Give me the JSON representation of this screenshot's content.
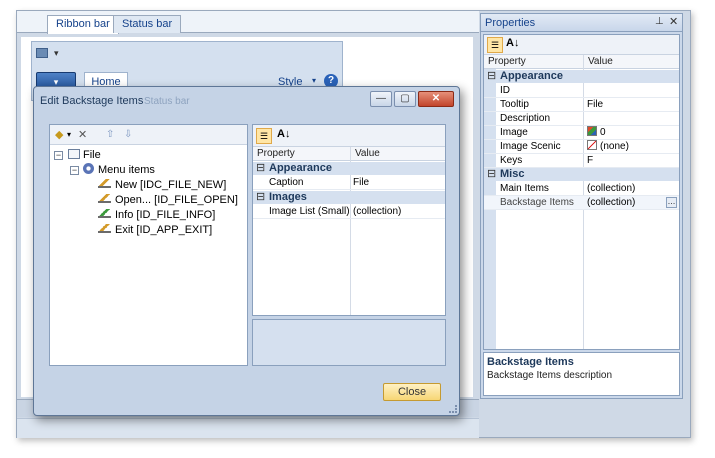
{
  "editor": {
    "tabs": [
      {
        "label": "Ribbon bar",
        "active": true
      },
      {
        "label": "Status bar",
        "active": false
      }
    ]
  },
  "ribbon": {
    "home_tab": "Home",
    "style_label": "Style",
    "help_glyph": "?",
    "app_button_glyph": "▾"
  },
  "dialog": {
    "title": "Edit Backstage Items",
    "ghost_text": "Status bar",
    "min_glyph": "—",
    "max_glyph": "▢",
    "close_glyph": "✕",
    "close_button": "Close",
    "tree": {
      "root": "File",
      "group": "Menu items",
      "items": [
        {
          "label": "New [IDC_FILE_NEW]",
          "icon": "command-icon"
        },
        {
          "label": "Open... [ID_FILE_OPEN]",
          "icon": "command-icon"
        },
        {
          "label": "Info [ID_FILE_INFO]",
          "icon": "command-icon-green"
        },
        {
          "label": "Exit [ID_APP_EXIT]",
          "icon": "command-icon"
        }
      ]
    },
    "grid": {
      "col_property": "Property",
      "col_value": "Value",
      "categories": [
        {
          "name": "Appearance",
          "rows": [
            {
              "name": "Caption",
              "value": "File"
            }
          ]
        },
        {
          "name": "Images",
          "rows": [
            {
              "name": "Image List (Small)",
              "value": "(collection)"
            }
          ]
        }
      ]
    }
  },
  "properties": {
    "title": "Properties",
    "pin_glyph": "⊥",
    "close_glyph": "✕",
    "col_property": "Property",
    "col_value": "Value",
    "appearance": {
      "name": "Appearance",
      "rows": [
        {
          "name": "ID",
          "value": ""
        },
        {
          "name": "Tooltip",
          "value": "File"
        },
        {
          "name": "Description",
          "value": ""
        },
        {
          "name": "Image",
          "value": "0"
        },
        {
          "name": "Image Scenic",
          "value": "(none)"
        },
        {
          "name": "Keys",
          "value": "F"
        }
      ]
    },
    "misc": {
      "name": "Misc",
      "rows": [
        {
          "name": "Main Items",
          "value": "(collection)"
        },
        {
          "name": "Backstage Items",
          "value": "(collection)"
        }
      ]
    },
    "description": {
      "title": "Backstage Items",
      "text": "Backstage Items description"
    }
  }
}
